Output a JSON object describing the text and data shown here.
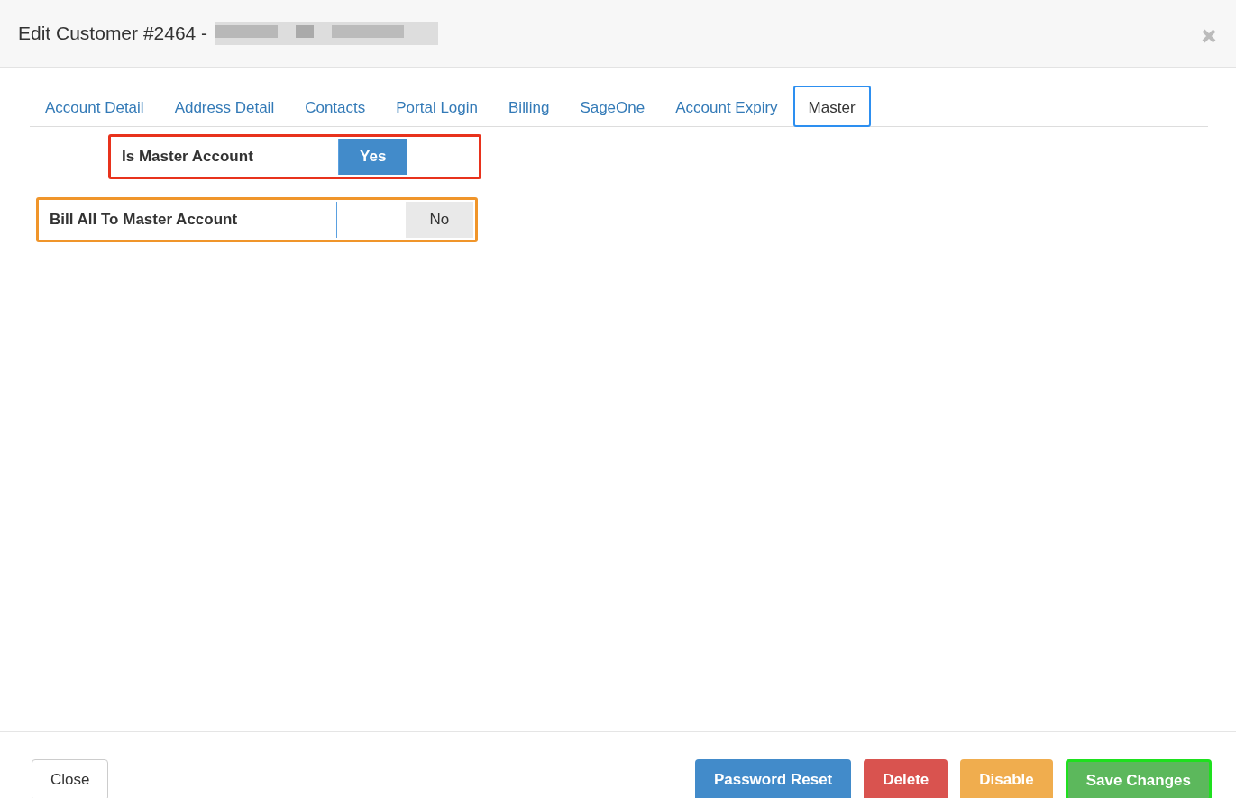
{
  "window": {
    "title": "Edit Customer #2464 -"
  },
  "tabs": [
    {
      "label": "Account Detail",
      "selected": false
    },
    {
      "label": "Address Detail",
      "selected": false
    },
    {
      "label": "Contacts",
      "selected": false
    },
    {
      "label": "Portal Login",
      "selected": false
    },
    {
      "label": "Billing",
      "selected": false
    },
    {
      "label": "SageOne",
      "selected": false
    },
    {
      "label": "Account Expiry",
      "selected": false
    },
    {
      "label": "Master",
      "selected": true,
      "color": "#2d8ff0"
    }
  ],
  "toggles": [
    {
      "label": "Is Master Account",
      "on": true,
      "state_text": "Yes",
      "color": "#e8321c"
    },
    {
      "label": "Bill All To Master Account",
      "on": false,
      "state_text": "No",
      "color": "#f0952a"
    }
  ],
  "footer": {
    "left_buttons": [
      {
        "label": "Close",
        "kind": "default"
      }
    ],
    "right_buttons": [
      {
        "label": "Password Reset",
        "kind": "primary"
      },
      {
        "label": "Delete",
        "kind": "danger"
      },
      {
        "label": "Disable",
        "kind": "warning"
      },
      {
        "label": "Save Changes",
        "kind": "success",
        "color": "#1ee01e"
      }
    ]
  }
}
